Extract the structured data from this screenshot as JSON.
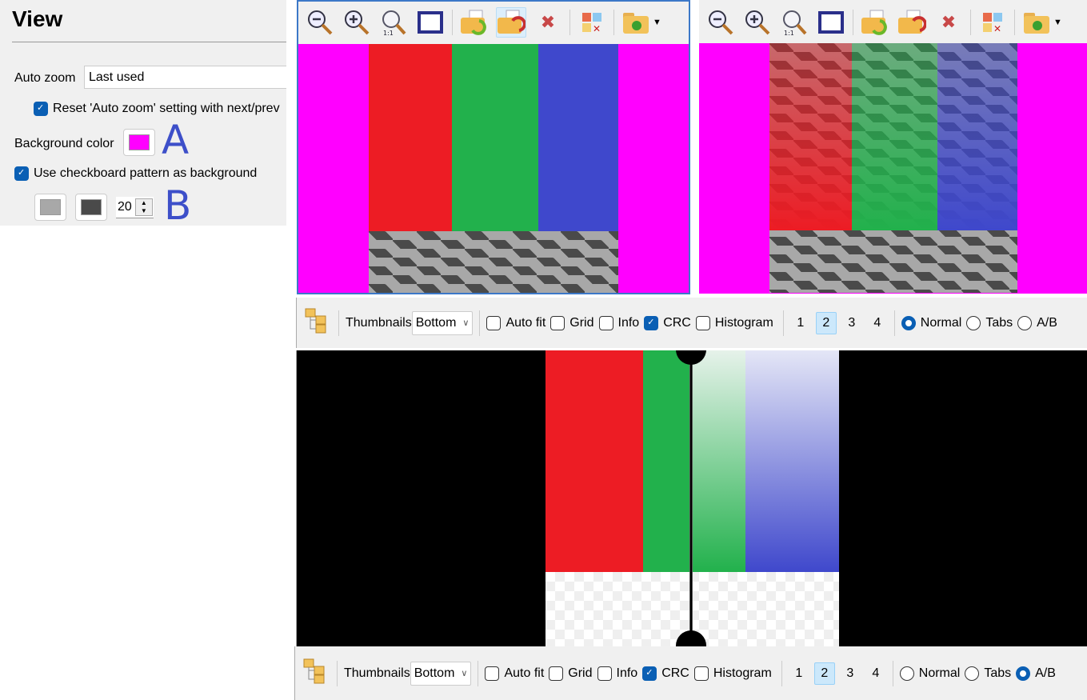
{
  "settings": {
    "title": "View",
    "auto_zoom_label": "Auto zoom",
    "auto_zoom_value": "Last used",
    "reset_label": "Reset 'Auto zoom' setting with next/prev",
    "reset_checked": true,
    "bg_color_label": "Background color",
    "bg_color": "#ff00ff",
    "checker_label": "Use checkboard pattern as background",
    "checker_checked": true,
    "checker_color1": "#a8a8a8",
    "checker_color2": "#4a4a4a",
    "checker_size": "20",
    "annotation_a": "A",
    "annotation_b": "B"
  },
  "toolbar_icons": [
    "zoom-out",
    "zoom-in",
    "zoom-1to1",
    "fit-to-window",
    "open-previous",
    "open-next",
    "close",
    "compare-grid",
    "open-folder"
  ],
  "bottom_toolbars": [
    {
      "thumbnails_label": "Thumbnails",
      "thumbnails_value": "Bottom",
      "autofit": "Auto fit",
      "grid": "Grid",
      "info": "Info",
      "crc": "CRC",
      "histogram": "Histogram",
      "nums": [
        "1",
        "2",
        "3",
        "4"
      ],
      "active_num": "2",
      "normal": "Normal",
      "tabs": "Tabs",
      "ab": "A/B",
      "mode": "Normal"
    },
    {
      "thumbnails_label": "Thumbnails",
      "thumbnails_value": "Bottom",
      "autofit": "Auto fit",
      "grid": "Grid",
      "info": "Info",
      "crc": "CRC",
      "histogram": "Histogram",
      "nums": [
        "1",
        "2",
        "3",
        "4"
      ],
      "active_num": "2",
      "normal": "Normal",
      "tabs": "Tabs",
      "ab": "A/B",
      "mode": "A/B"
    }
  ],
  "colors": {
    "red": "#ed1c24",
    "green": "#22b14c",
    "blue": "#3f48cc",
    "accent": "#0a5fb4"
  }
}
